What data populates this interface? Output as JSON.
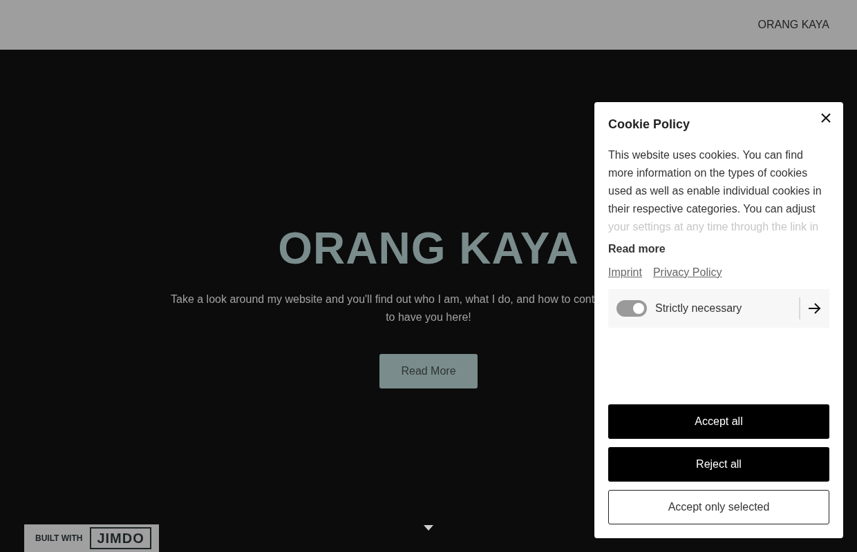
{
  "header": {
    "site_name": "ORANG KAYA"
  },
  "hero": {
    "title": "ORANG KAYA",
    "text_line_1": "Take a look around my website and you'll find out who I am, what I do, and how to cont",
    "text_line_2": "to have you here!",
    "button": "Read More"
  },
  "badge": {
    "label": "BUILT WITH",
    "logo": "JIMDO"
  },
  "cookie_panel": {
    "title": "Cookie Policy",
    "text": "This website uses cookies. You can find more information on the types of cookies used as well as enable individual cookies in their respective categories. You can adjust",
    "faded_line": "your settings at any time through the link in",
    "read_more": "Read more",
    "links": [
      "Imprint",
      "Privacy Policy"
    ],
    "categories": [
      {
        "label": "Strictly necessary",
        "checked": true,
        "disabled": true
      }
    ],
    "buttons": [
      {
        "label": "Accept all",
        "kind": "primary"
      },
      {
        "label": "Reject all",
        "kind": "primary"
      },
      {
        "label": "Accept only selected",
        "kind": "outline"
      }
    ]
  }
}
